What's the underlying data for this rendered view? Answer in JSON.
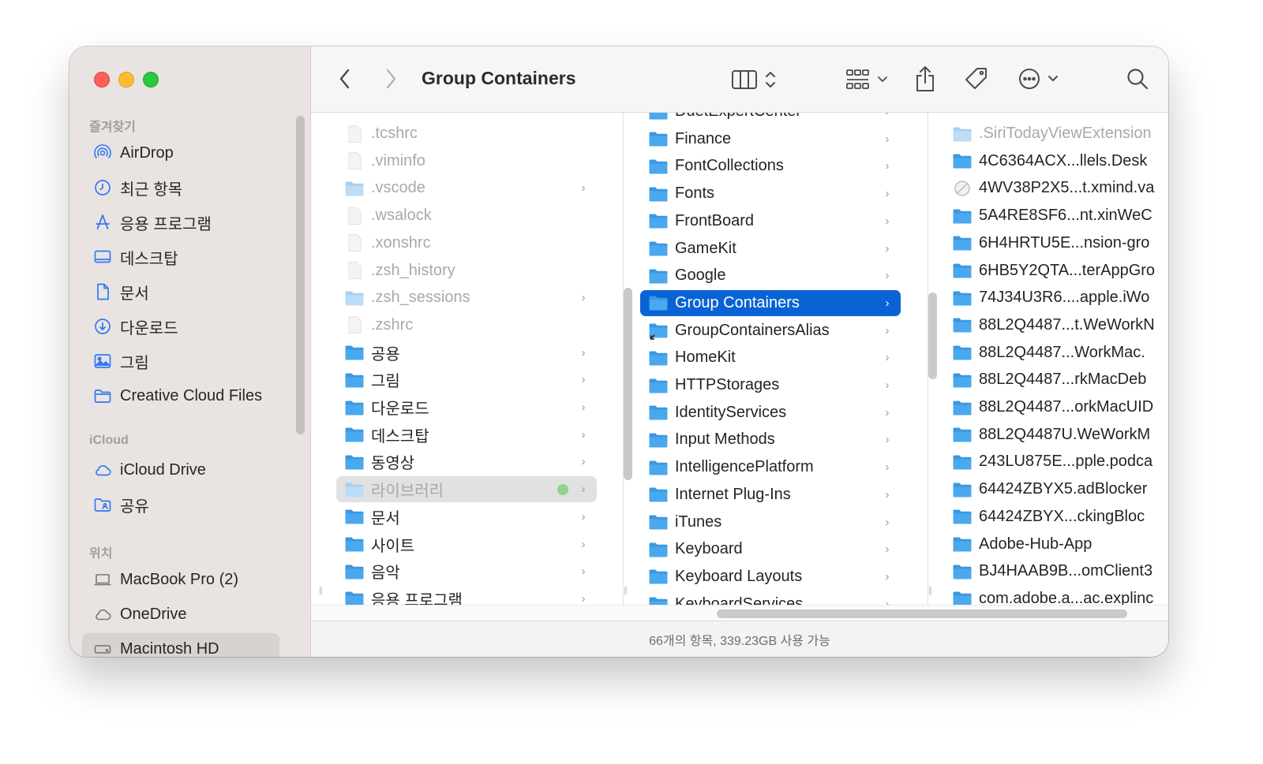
{
  "window": {
    "title": "Group Containers"
  },
  "sidebar": {
    "favorites_title": "즐겨찾기",
    "favorites": [
      {
        "label": "AirDrop",
        "icon": "airdrop-icon"
      },
      {
        "label": "최근 항목",
        "icon": "clock-icon"
      },
      {
        "label": "응용 프로그램",
        "icon": "applications-icon"
      },
      {
        "label": "데스크탑",
        "icon": "desktop-icon"
      },
      {
        "label": "문서",
        "icon": "document-icon"
      },
      {
        "label": "다운로드",
        "icon": "download-icon"
      },
      {
        "label": "그림",
        "icon": "pictures-icon"
      },
      {
        "label": "Creative Cloud Files",
        "icon": "folder-icon"
      }
    ],
    "icloud_title": "iCloud",
    "icloud": [
      {
        "label": "iCloud Drive",
        "icon": "cloud-icon"
      },
      {
        "label": "공유",
        "icon": "shared-folder-icon"
      }
    ],
    "locations_title": "위치",
    "locations": [
      {
        "label": "MacBook Pro (2)",
        "icon": "laptop-icon"
      },
      {
        "label": "OneDrive",
        "icon": "cloud-icon"
      },
      {
        "label": "Macintosh HD",
        "icon": "disk-icon",
        "selected": true
      }
    ]
  },
  "toolbar": {
    "back": "back-chevron-icon",
    "forward": "forward-chevron-icon",
    "view": "column-view-icon",
    "group": "grid-group-icon",
    "share": "share-icon",
    "tag": "tag-icon",
    "more": "more-ellipsis-icon",
    "search": "search-icon"
  },
  "columns": {
    "col1": [
      {
        "label": ".tcshrc",
        "dim": true,
        "kind": "file"
      },
      {
        "label": ".viminfo",
        "dim": true,
        "kind": "file"
      },
      {
        "label": ".vscode",
        "dim": true,
        "kind": "folder",
        "chevron": true
      },
      {
        "label": ".wsalock",
        "dim": true,
        "kind": "file"
      },
      {
        "label": ".xonshrc",
        "dim": true,
        "kind": "file"
      },
      {
        "label": ".zsh_history",
        "dim": true,
        "kind": "file"
      },
      {
        "label": ".zsh_sessions",
        "dim": true,
        "kind": "folder",
        "chevron": true
      },
      {
        "label": ".zshrc",
        "dim": true,
        "kind": "file"
      },
      {
        "label": "공용",
        "kind": "folder",
        "chevron": true
      },
      {
        "label": "그림",
        "kind": "folder",
        "chevron": true
      },
      {
        "label": "다운로드",
        "kind": "folder",
        "chevron": true
      },
      {
        "label": "데스크탑",
        "kind": "folder",
        "chevron": true
      },
      {
        "label": "동영상",
        "kind": "folder",
        "chevron": true
      },
      {
        "label": "라이브러리",
        "kind": "folder",
        "chevron": true,
        "hover": true,
        "dim": true,
        "tag": true
      },
      {
        "label": "문서",
        "kind": "folder",
        "chevron": true
      },
      {
        "label": "사이트",
        "kind": "folder",
        "chevron": true
      },
      {
        "label": "음악",
        "kind": "folder",
        "chevron": true
      },
      {
        "label": "응용 프로그램",
        "kind": "folder",
        "chevron": true
      }
    ],
    "col2": [
      {
        "label": "DuetExpertCenter",
        "kind": "folder",
        "chevron": true
      },
      {
        "label": "Finance",
        "kind": "folder",
        "chevron": true
      },
      {
        "label": "FontCollections",
        "kind": "folder",
        "chevron": true
      },
      {
        "label": "Fonts",
        "kind": "folder",
        "chevron": true
      },
      {
        "label": "FrontBoard",
        "kind": "folder",
        "chevron": true
      },
      {
        "label": "GameKit",
        "kind": "folder",
        "chevron": true
      },
      {
        "label": "Google",
        "kind": "folder",
        "chevron": true
      },
      {
        "label": "Group Containers",
        "kind": "folder",
        "chevron": true,
        "selected": true
      },
      {
        "label": "GroupContainersAlias",
        "kind": "alias",
        "chevron": true
      },
      {
        "label": "HomeKit",
        "kind": "folder",
        "chevron": true
      },
      {
        "label": "HTTPStorages",
        "kind": "folder",
        "chevron": true
      },
      {
        "label": "IdentityServices",
        "kind": "folder",
        "chevron": true
      },
      {
        "label": "Input Methods",
        "kind": "folder",
        "chevron": true
      },
      {
        "label": "IntelligencePlatform",
        "kind": "folder",
        "chevron": true
      },
      {
        "label": "Internet Plug-Ins",
        "kind": "folder",
        "chevron": true
      },
      {
        "label": "iTunes",
        "kind": "folder",
        "chevron": true
      },
      {
        "label": "Keyboard",
        "kind": "folder",
        "chevron": true
      },
      {
        "label": "Keyboard Layouts",
        "kind": "folder",
        "chevron": true
      },
      {
        "label": "KeyboardServices",
        "kind": "folder",
        "chevron": true
      }
    ],
    "col3": [
      {
        "label": ".SiriTodayViewExtension",
        "dim": true,
        "kind": "folder"
      },
      {
        "label": "4C6364ACX...llels.Desk",
        "kind": "folder"
      },
      {
        "label": "4WV38P2X5...t.xmind.va",
        "kind": "blocked"
      },
      {
        "label": "5A4RE8SF6...nt.xinWeC",
        "kind": "folder"
      },
      {
        "label": "6H4HRTU5E...nsion-gro",
        "kind": "folder"
      },
      {
        "label": "6HB5Y2QTA...terAppGro",
        "kind": "folder"
      },
      {
        "label": "74J34U3R6....apple.iWo",
        "kind": "folder"
      },
      {
        "label": "88L2Q4487...t.WeWorkN",
        "kind": "folder"
      },
      {
        "label": "88L2Q4487...WorkMac.",
        "kind": "folder"
      },
      {
        "label": "88L2Q4487...rkMacDeb",
        "kind": "folder"
      },
      {
        "label": "88L2Q4487...orkMacUID",
        "kind": "folder"
      },
      {
        "label": "88L2Q4487U.WeWorkM",
        "kind": "folder"
      },
      {
        "label": "243LU875E...pple.podca",
        "kind": "folder"
      },
      {
        "label": "64424ZBYX5.adBlocker",
        "kind": "folder"
      },
      {
        "label": "64424ZBYX...ckingBloc",
        "kind": "folder"
      },
      {
        "label": "Adobe-Hub-App",
        "kind": "folder"
      },
      {
        "label": "BJ4HAAB9B...omClient3",
        "kind": "folder"
      },
      {
        "label": "com.adobe.a...ac.explinc",
        "kind": "folder"
      }
    ]
  },
  "status": {
    "text": "66개의 항목, 339.23GB 사용 가능"
  },
  "colors": {
    "accent": "#0a63d4",
    "folder": "#4aa9ee"
  }
}
